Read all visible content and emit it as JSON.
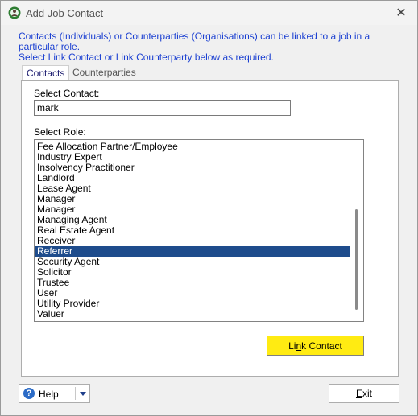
{
  "window": {
    "title": "Add Job Contact",
    "close_glyph": "✕"
  },
  "description": {
    "line1": "Contacts (Individuals) or Counterparties (Organisations) can be linked to a job in a particular role.",
    "line2": "Select Link Contact or Link Counterparty below as required."
  },
  "tabs": [
    {
      "label": "Contacts",
      "active": true
    },
    {
      "label": "Counterparties",
      "active": false
    }
  ],
  "contact": {
    "label": "Select Contact:",
    "value": "mark"
  },
  "roles": {
    "label": "Select Role:",
    "items": [
      "Fee Allocation Partner/Employee",
      "Industry Expert",
      "Insolvency Practitioner",
      "Landlord",
      "Lease Agent",
      "Manager",
      "Manager",
      "Managing Agent",
      "Real Estate Agent",
      "Receiver",
      "Referrer",
      "Security Agent",
      "Solicitor",
      "Trustee",
      "User",
      "Utility Provider",
      "Valuer"
    ],
    "selected_index": 10
  },
  "buttons": {
    "link_contact_pre": "Li",
    "link_contact_ul": "n",
    "link_contact_post": "k Contact",
    "help": "Help",
    "exit_ul": "E",
    "exit_post": "xit"
  },
  "icons": {
    "app": "app-person-icon",
    "help": "help-question-icon",
    "dropdown": "chevron-down-icon",
    "close": "close-icon"
  },
  "colors": {
    "description_text": "#1a3fd1",
    "selected_row": "#1e4c8c",
    "link_button": "#ffeb12",
    "help_icon": "#2b6bc6"
  }
}
